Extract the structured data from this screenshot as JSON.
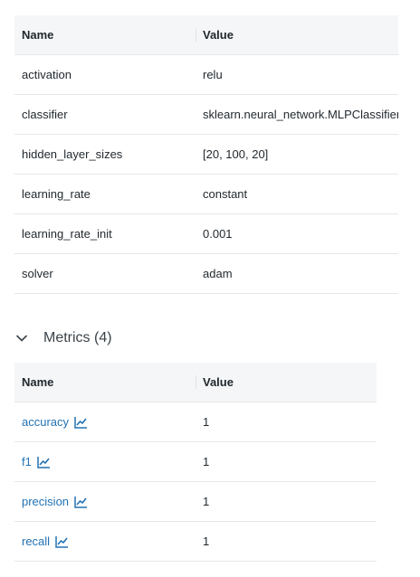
{
  "params": {
    "header": {
      "name": "Name",
      "value": "Value"
    },
    "rows": [
      {
        "name": "activation",
        "value": "relu"
      },
      {
        "name": "classifier",
        "value": "sklearn.neural_network.MLPClassifier"
      },
      {
        "name": "hidden_layer_sizes",
        "value": "[20, 100, 20]"
      },
      {
        "name": "learning_rate",
        "value": "constant"
      },
      {
        "name": "learning_rate_init",
        "value": "0.001"
      },
      {
        "name": "solver",
        "value": "adam"
      }
    ]
  },
  "metrics": {
    "section_title": "Metrics (4)",
    "header": {
      "name": "Name",
      "value": "Value"
    },
    "rows": [
      {
        "name": "accuracy",
        "value": "1"
      },
      {
        "name": "f1",
        "value": "1"
      },
      {
        "name": "precision",
        "value": "1"
      },
      {
        "name": "recall",
        "value": "1"
      }
    ]
  },
  "icons": {
    "chevron": "chevron-down-icon",
    "metric_chart": "line-chart-icon"
  },
  "colors": {
    "link": "#2272b4",
    "header_bg": "#f5f6f7",
    "border": "#e4e7ea",
    "text": "#1f272d"
  }
}
